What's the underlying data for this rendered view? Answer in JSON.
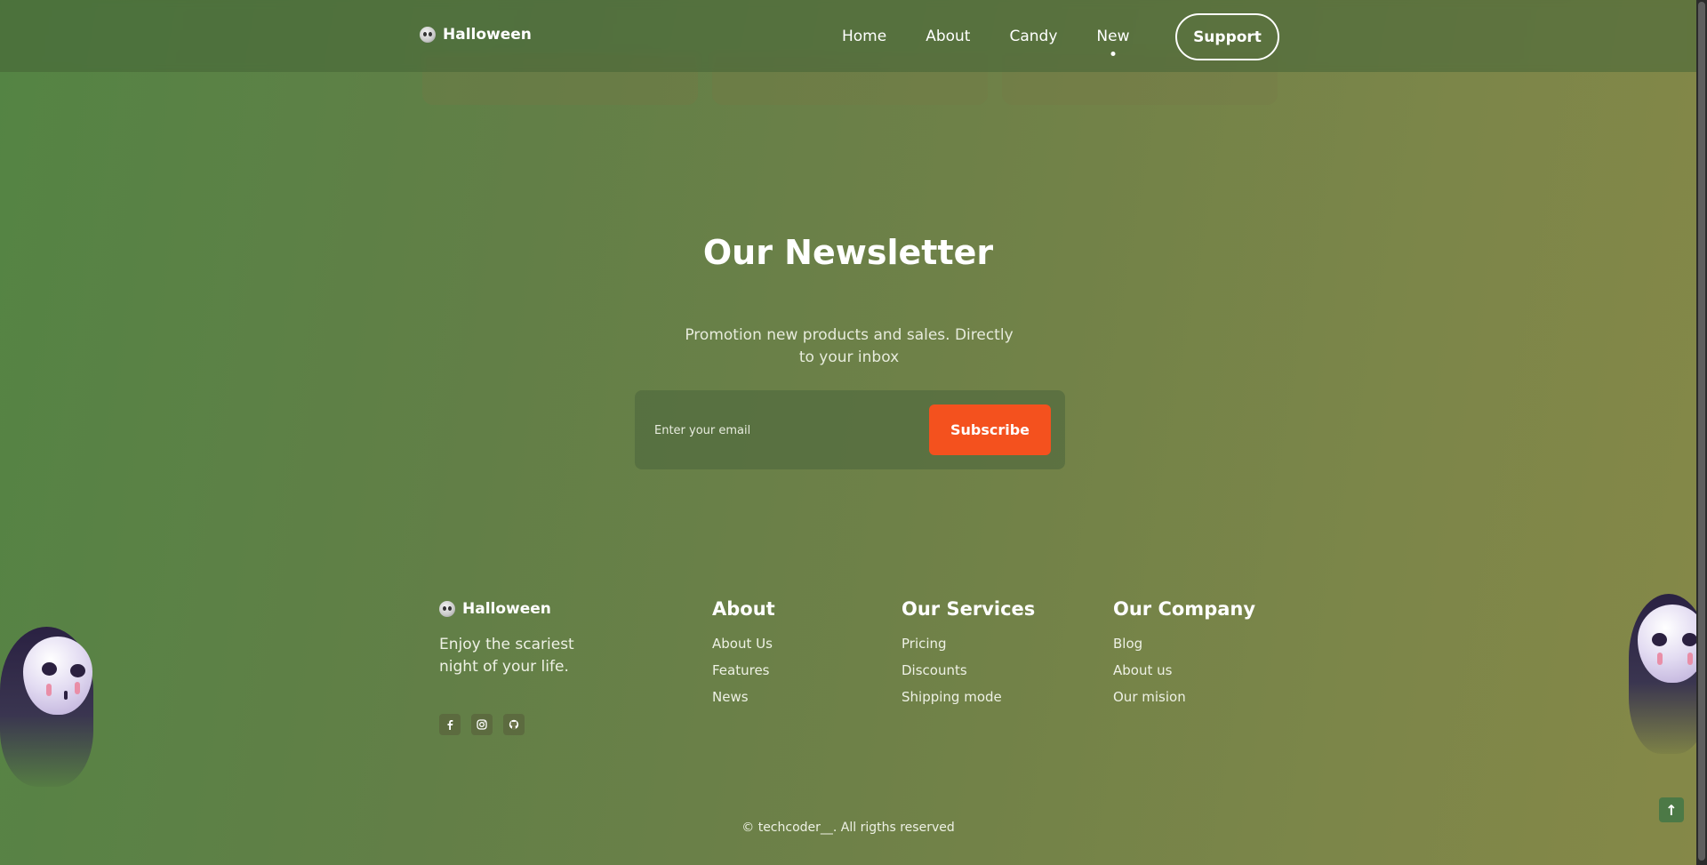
{
  "header": {
    "brand": "Halloween",
    "nav": [
      "Home",
      "About",
      "Candy",
      "New"
    ],
    "active_nav": "New",
    "support_label": "Support"
  },
  "newsletter": {
    "title": "Our Newsletter",
    "description": "Promotion new products and sales. Directly to your inbox",
    "email_placeholder": "Enter your email",
    "subscribe_label": "Subscribe"
  },
  "footer": {
    "brand": "Halloween",
    "tagline": "Enjoy the scariest night of your life.",
    "socials": [
      "facebook-icon",
      "instagram-icon",
      "github-icon"
    ],
    "columns": [
      {
        "title": "About",
        "links": [
          "About Us",
          "Features",
          "News"
        ]
      },
      {
        "title": "Our Services",
        "links": [
          "Pricing",
          "Discounts",
          "Shipping mode"
        ]
      },
      {
        "title": "Our Company",
        "links": [
          "Blog",
          "About us",
          "Our mision"
        ]
      }
    ],
    "copyright": "© techcoder__. All rigths reserved"
  },
  "colors": {
    "accent": "#f4511e",
    "background_start": "#548444",
    "background_end": "#858848"
  }
}
